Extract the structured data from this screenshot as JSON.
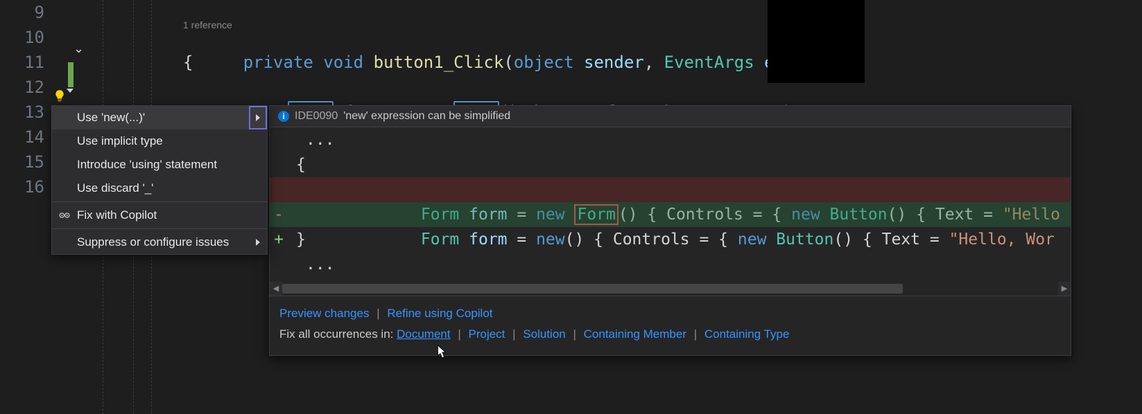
{
  "gutter": {
    "l9": "9",
    "l10": "10",
    "l11": "11",
    "l12": "12",
    "l13": "13",
    "l14": "14",
    "l15": "15",
    "l16": "16"
  },
  "codelens": "1 reference",
  "code": {
    "private": "private",
    "void": "void",
    "method": "button1_Click",
    "obj": "object",
    "sender": "sender",
    "comma": ",",
    "eventargs": "EventArgs",
    "e": "e",
    "openParen": "(",
    "closeParen": ")",
    "openBrace": "{",
    "closeBrace": "}",
    "Form": "Form",
    "form": "form",
    "equals": "=",
    "new": "new",
    "Controls": "Controls",
    "Button": "Button"
  },
  "menu": {
    "use_new": "Use 'new(...)'",
    "implicit": "Use implicit type",
    "using": "Introduce 'using' statement",
    "discard": "Use discard '_'",
    "copilot": "Fix with Copilot",
    "suppress": "Suppress or configure issues"
  },
  "preview": {
    "ide_code": "IDE0090",
    "message": "'new' expression can be simplified",
    "ellipsis": "...",
    "openBrace": "{",
    "closeBrace": "}",
    "del": {
      "pre": "        ",
      "Form": "Form",
      "sp": " ",
      "form": "form",
      "eq": " = ",
      "new": "new",
      " Form": "Form",
      "paren": "()",
      "obr": " { ",
      "Controls": "Controls",
      "eq2": " = { ",
      "new2": "new",
      "sp2": " ",
      "Button": "Button",
      "paren2": "()",
      "obr2": " { ",
      "Text": "Text",
      "eq3": " = ",
      "hello": "\"Hello"
    },
    "add": {
      "pre": "        ",
      "Form": "Form",
      "sp": " ",
      "form": "form",
      "eq": " = ",
      "new": "new",
      "paren": "()",
      "obr": " { ",
      "Controls": "Controls",
      "eq2": " = { ",
      "new2": "new",
      "sp2": " ",
      "Button": "Button",
      "paren2": "()",
      "obr2": " { ",
      "Text": "Text",
      "eq3": " = ",
      "hello": "\"Hello, Wor"
    },
    "footer": {
      "preview_changes": "Preview changes",
      "refine": "Refine using Copilot",
      "fix_all": "Fix all occurrences in:",
      "document": "Document",
      "project": "Project",
      "solution": "Solution",
      "member": "Containing Member",
      "type": "Containing Type"
    }
  }
}
